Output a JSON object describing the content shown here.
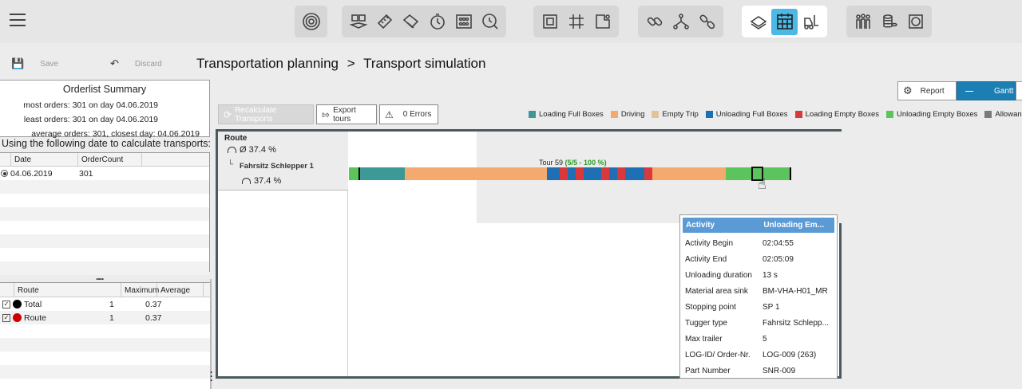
{
  "toolbar": {
    "group1": [
      "target-icon"
    ],
    "group2": [
      "boxes-icon",
      "ruler-icon",
      "tag-icon",
      "clock-icon",
      "grid-dots-icon",
      "search-clock-icon"
    ],
    "group3": [
      "frame-icon",
      "grid-icon",
      "layout-icon"
    ],
    "group4": [
      "link-icon",
      "fork-icon",
      "unlink-icon"
    ],
    "group5": [
      "transport-icon",
      "calendar-grid-icon",
      "forklift-icon"
    ],
    "group6": [
      "people-icon",
      "coins-icon",
      "box-icon"
    ]
  },
  "actions": {
    "save": "Save",
    "discard": "Discard"
  },
  "breadcrumb": {
    "parent": "Transportation planning",
    "separator": ">",
    "current": "Transport simulation"
  },
  "summary": {
    "title": "Orderlist Summary",
    "most": "most orders: 301 on day 04.06.2019",
    "least": "least orders: 301 on day 04.06.2019",
    "average": "average orders: 301, closest day: 04.06.2019"
  },
  "date_caption": "Using the following date to calculate transports:",
  "date_table": {
    "headers": [
      "Date",
      "OrderCount"
    ],
    "rows": [
      {
        "date": "04.06.2019",
        "count": "301"
      }
    ]
  },
  "splitter_dots": "....",
  "route_table": {
    "headers": [
      "Route",
      "Maximum",
      "Average"
    ],
    "rows": [
      {
        "name": "Total",
        "max": "1",
        "avg": "0.37",
        "color": "#000000"
      },
      {
        "name": "Route",
        "max": "1",
        "avg": "0.37",
        "color": "#cc0000"
      }
    ]
  },
  "view_switch": {
    "report": "Report",
    "gantt": "Gantt"
  },
  "buttons": {
    "recalculate": "Recalculate Transports",
    "export": "Export tours",
    "errors": "0 Errors"
  },
  "legend": [
    {
      "label": "Loading Full Boxes",
      "color": "#3d9995"
    },
    {
      "label": "Driving",
      "color": "#f4aa6e"
    },
    {
      "label": "Empty Trip",
      "color": "#dfc49a"
    },
    {
      "label": "Unloading Full Boxes",
      "color": "#1f6fb5"
    },
    {
      "label": "Loading Empty Boxes",
      "color": "#d9393d"
    },
    {
      "label": "Unloading Empty Boxes",
      "color": "#5cc45c"
    },
    {
      "label": "Allowance time",
      "color": "#7a7a7a"
    }
  ],
  "gantt": {
    "route_label": "Route",
    "route_avg": "Ø 37.4 %",
    "tugger_name": "Fahrsitz Schlepper 1",
    "tugger_pct": "37.4 %",
    "tour_label": "Tour 59",
    "tour_stats": "(5/5 - 100 %)"
  },
  "tooltip": {
    "header": {
      "key": "Activity",
      "value": "Unloading Em..."
    },
    "rows": [
      {
        "key": "Activity Begin",
        "value": "02:04:55"
      },
      {
        "key": "Activity End",
        "value": "02:05:09"
      },
      {
        "key": "Unloading duration",
        "value": "13 s"
      },
      {
        "key": "Material area sink",
        "value": "BM-VHA-H01_MR"
      },
      {
        "key": "Stopping point",
        "value": "SP 1"
      },
      {
        "key": "Tugger type",
        "value": "Fahrsitz Schlepp..."
      },
      {
        "key": "Max trailer",
        "value": "5"
      },
      {
        "key": "LOG-ID/ Order-Nr.",
        "value": "LOG-009 (263)"
      },
      {
        "key": "Part Number",
        "value": "SNR-009"
      }
    ]
  }
}
